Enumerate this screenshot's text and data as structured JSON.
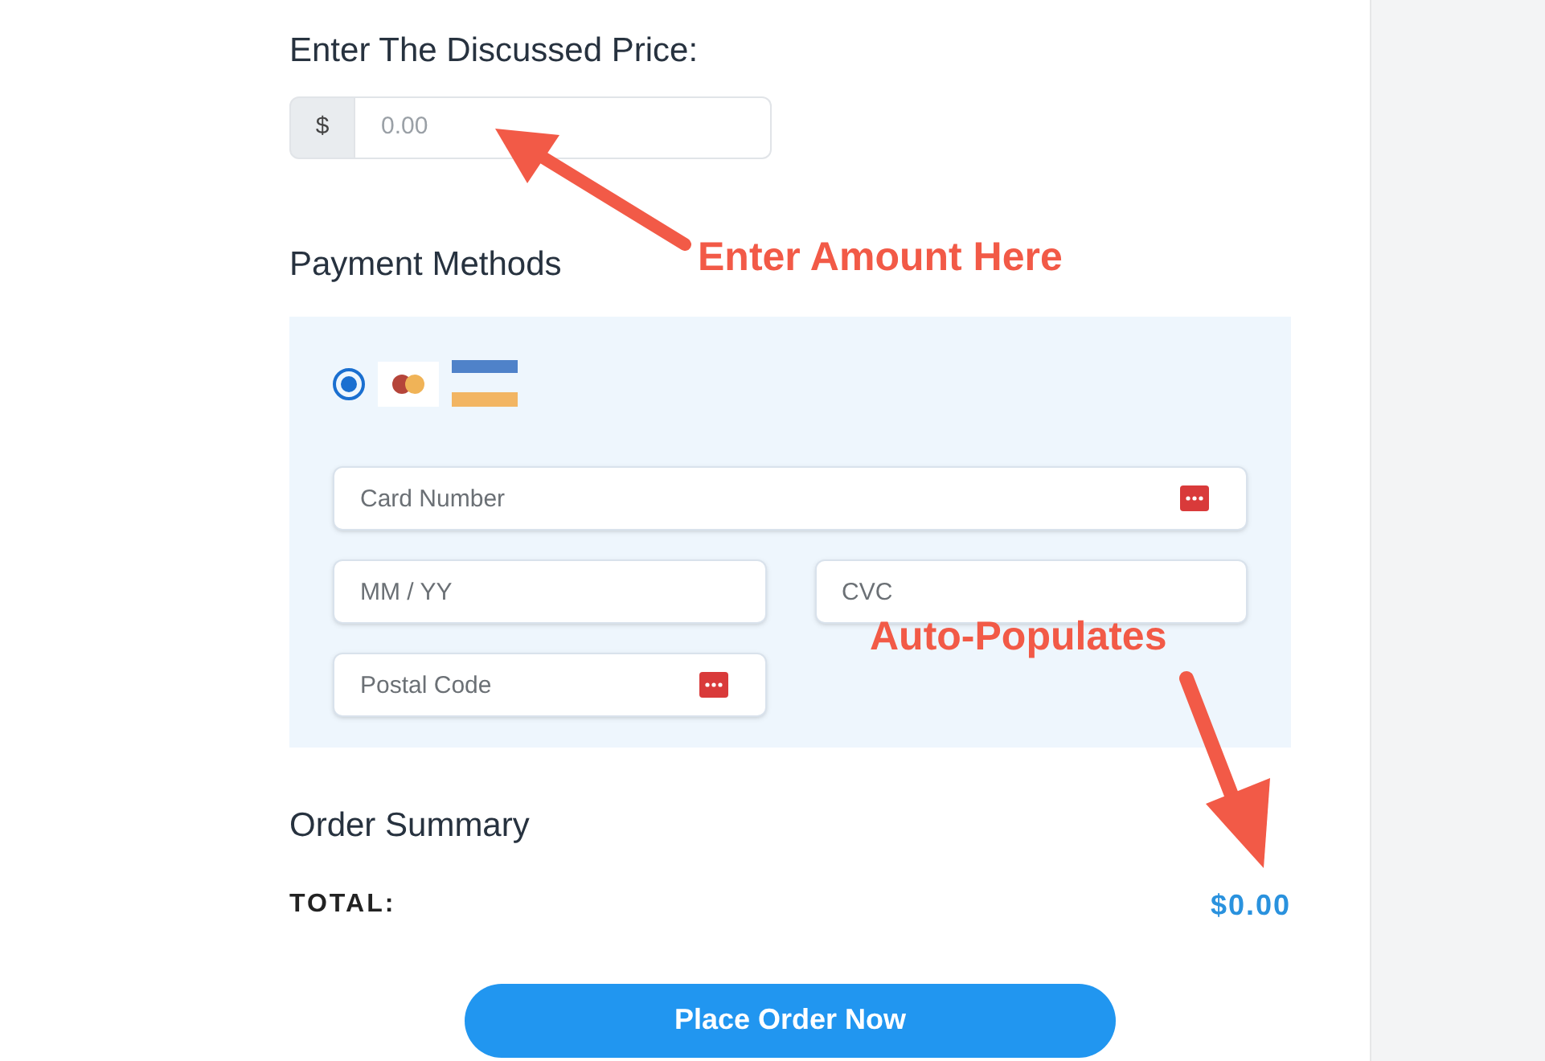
{
  "price": {
    "label": "Enter The Discussed Price:",
    "currency": "$",
    "placeholder": "0.00"
  },
  "payment": {
    "title": "Payment Methods",
    "methods": [
      {
        "selected": true
      }
    ],
    "fields": [
      {
        "placeholder": "Card Number",
        "icon": true
      },
      {
        "placeholder": "MM / YY",
        "icon": false
      },
      {
        "placeholder": "CVC",
        "icon": false
      },
      {
        "placeholder": "Postal Code",
        "icon": true
      }
    ]
  },
  "summary": {
    "title": "Order Summary",
    "total_label": "TOTAL:",
    "total_value": "$0.00"
  },
  "submit": {
    "label": "Place Order Now"
  },
  "annotations": [
    {
      "text": "Enter Amount Here"
    },
    {
      "text": "Auto-Populates"
    }
  ]
}
